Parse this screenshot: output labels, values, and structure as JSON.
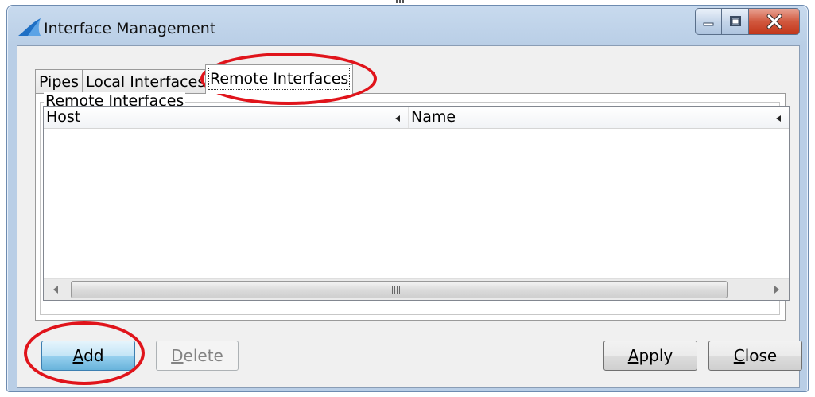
{
  "window": {
    "title": "Interface Management",
    "app_icon": "shark-fin-icon",
    "caption_buttons": {
      "minimize": "minimize-icon",
      "maximize": "maximize-icon",
      "close": "close-icon"
    }
  },
  "tabs": [
    {
      "label": "Pipes",
      "active": false
    },
    {
      "label": "Local Interfaces",
      "active": false
    },
    {
      "label": "Remote Interfaces",
      "active": true
    }
  ],
  "group": {
    "label": "Remote Interfaces"
  },
  "list": {
    "columns": [
      {
        "label": "Host"
      },
      {
        "label": "Name"
      }
    ],
    "rows": []
  },
  "buttons": {
    "add": {
      "label": "Add",
      "mnemonic_index": 0,
      "enabled": true
    },
    "delete": {
      "label": "Delete",
      "mnemonic_index": 0,
      "enabled": false
    },
    "apply": {
      "label": "Apply",
      "mnemonic_index": 0,
      "enabled": true
    },
    "close": {
      "label": "Close",
      "mnemonic_index": 0,
      "enabled": true
    }
  },
  "colors": {
    "annotation": "#e0141b",
    "window_frame": "#b9cee6",
    "default_button": "#98d1ef"
  }
}
